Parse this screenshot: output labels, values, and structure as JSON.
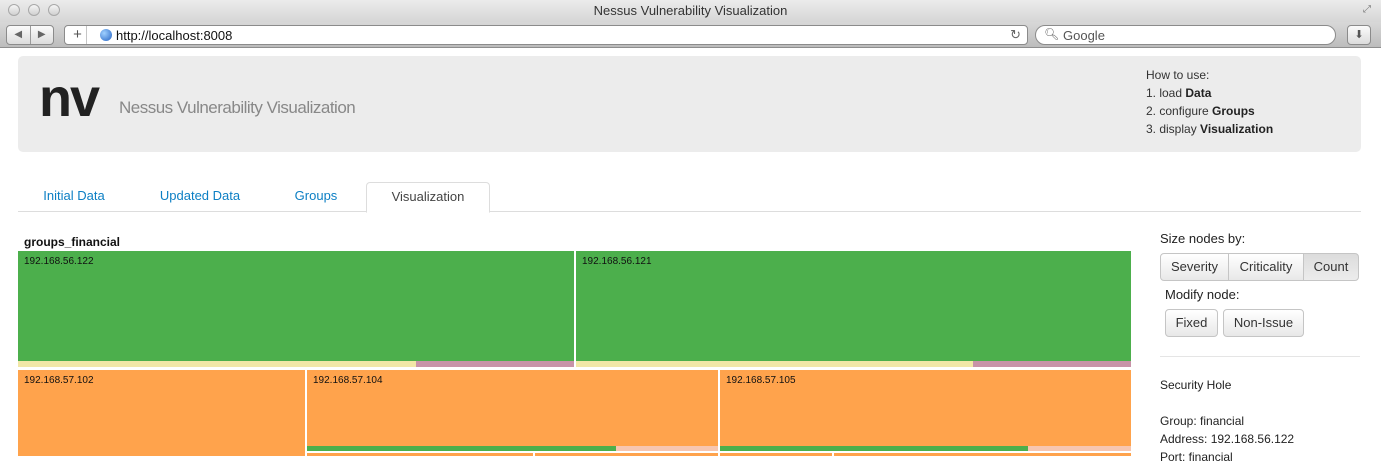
{
  "browser": {
    "window_title": "Nessus Vulnerability Visualization",
    "url": "http://localhost:8008",
    "search_placeholder": "Google"
  },
  "header": {
    "logo": "nv",
    "subtitle": "Nessus Vulnerability Visualization",
    "howto_title": "How to use:",
    "steps": [
      {
        "num": "1. load ",
        "bold": "Data"
      },
      {
        "num": "2. configure ",
        "bold": "Groups"
      },
      {
        "num": "3. display ",
        "bold": "Visualization"
      }
    ]
  },
  "tabs": [
    {
      "label": "Initial Data",
      "active": false
    },
    {
      "label": "Updated Data",
      "active": false
    },
    {
      "label": "Groups",
      "active": false
    },
    {
      "label": "Visualization",
      "active": true
    }
  ],
  "treemap": {
    "group_title": "groups_financial",
    "nodes": [
      {
        "label": "192.168.56.122",
        "color": "#4caf4c"
      },
      {
        "label": "192.168.56.121",
        "color": "#4caf4c"
      },
      {
        "label": "192.168.57.102",
        "color": "#ffa34c"
      },
      {
        "label": "192.168.57.104",
        "color": "#ffa34c"
      },
      {
        "label": "192.168.57.105",
        "color": "#ffa34c"
      }
    ]
  },
  "side_panel": {
    "size_label": "Size nodes by:",
    "size_buttons": [
      {
        "label": "Severity",
        "active": false
      },
      {
        "label": "Criticality",
        "active": false
      },
      {
        "label": "Count",
        "active": true
      }
    ],
    "modify_label": "Modify node:",
    "modify_buttons": [
      "Fixed",
      "Non-Issue"
    ],
    "detail": {
      "severity": "Security Hole",
      "group": "Group: financial",
      "address": "Address: 192.168.56.122",
      "port": "Port: financial"
    }
  },
  "colors": {
    "green": "#4caf4c",
    "orange": "#ffa34c",
    "link": "#0c7fc4"
  }
}
